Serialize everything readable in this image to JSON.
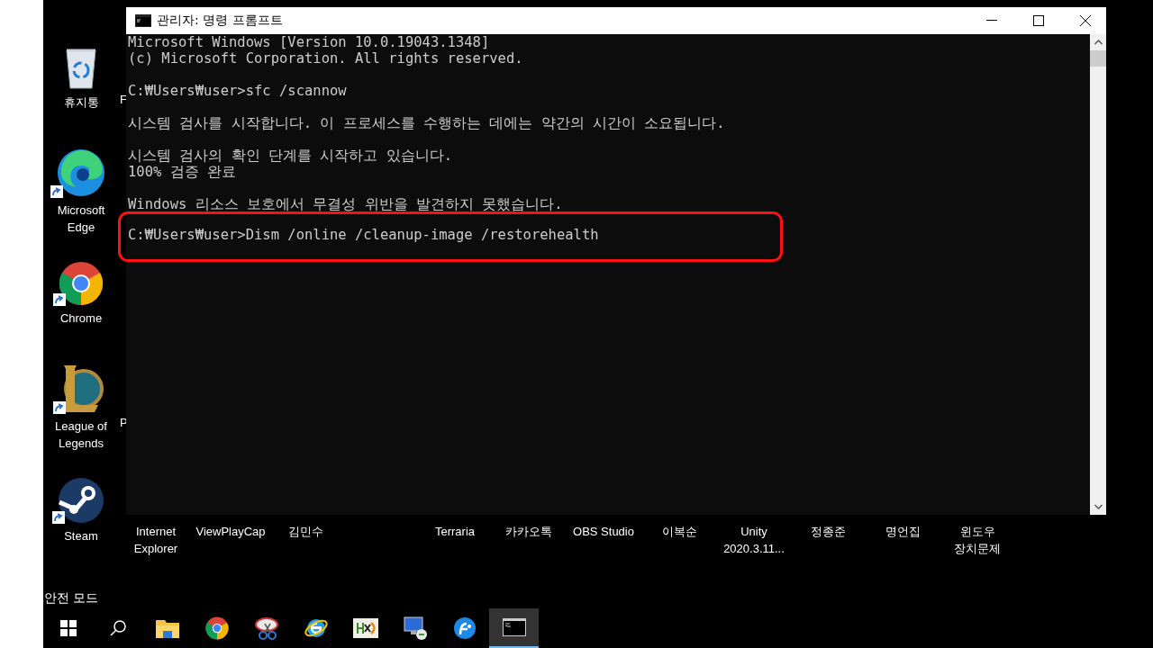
{
  "desktop_icons": [
    {
      "kind": "recycle",
      "label": "휴지통",
      "shortcut": false
    },
    {
      "kind": "edge",
      "label": "Microsoft Edge",
      "shortcut": true
    },
    {
      "kind": "chrome",
      "label": "Chrome",
      "shortcut": true
    },
    {
      "kind": "lol",
      "label": "League of Legends",
      "shortcut": true
    },
    {
      "kind": "steam",
      "label": "Steam",
      "shortcut": true
    }
  ],
  "cut_labels": [
    "F",
    "P"
  ],
  "bottom_row_labels": [
    "Internet Explorer",
    "ViewPlayCap",
    "김민수",
    "Terraria",
    "카카오톡",
    "OBS Studio",
    "이복순",
    "Unity 2020.3.11...",
    "정종준",
    "명언집",
    "윈도우 장치문제"
  ],
  "window": {
    "title": "관리자: 명령 프롬프트",
    "blocks": [
      {
        "lines": [
          "Microsoft Windows [Version 10.0.19043.1348]",
          "(c) Microsoft Corporation. All rights reserved."
        ],
        "highlighted": false
      },
      {
        "lines": [
          "C:₩Users₩user>sfc /scannow"
        ],
        "highlighted": false
      },
      {
        "lines": [
          "시스템 검사를 시작합니다. 이 프로세스를 수행하는 데에는 약간의 시간이 소요됩니다."
        ],
        "highlighted": false
      },
      {
        "lines": [
          "시스템 검사의 확인 단계를 시작하고 있습니다.",
          "100% 검증 완료"
        ],
        "highlighted": false
      },
      {
        "lines": [
          "Windows 리소스 보호에서 무결성 위반을 발견하지 못했습니다."
        ],
        "highlighted": false
      },
      {
        "lines": [
          "C:₩Users₩user>Dism /online /cleanup-image /restorehealth"
        ],
        "highlighted": true
      }
    ]
  },
  "safe_mode_label": "안전 모드",
  "taskbar": [
    {
      "kind": "start",
      "selected": false
    },
    {
      "kind": "search",
      "selected": false
    },
    {
      "kind": "folder",
      "selected": false
    },
    {
      "kind": "chrome",
      "selected": false
    },
    {
      "kind": "snip",
      "selected": false
    },
    {
      "kind": "ie",
      "selected": false
    },
    {
      "kind": "hex",
      "selected": false
    },
    {
      "kind": "remote",
      "selected": false
    },
    {
      "kind": "blueapp",
      "selected": false
    },
    {
      "kind": "console",
      "selected": true
    }
  ]
}
